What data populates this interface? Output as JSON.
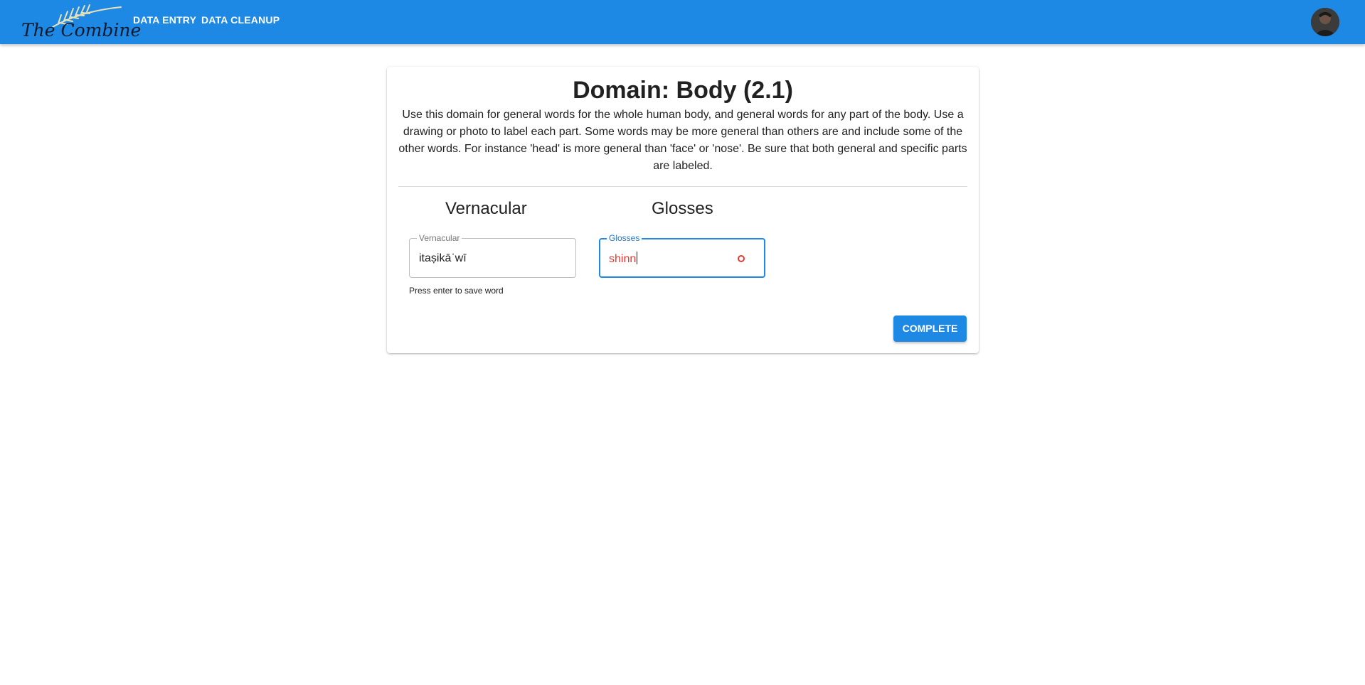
{
  "app": {
    "logo_text": "The Combine",
    "nav": {
      "data_entry": "DATA ENTRY",
      "data_cleanup": "DATA CLEANUP"
    },
    "accent_color": "#1e88e5"
  },
  "domain": {
    "title": "Domain: Body (2.1)",
    "description": "Use this domain for general words for the whole human body, and general words for any part of the body. Use a drawing or photo to label each part. Some words may be more general than others are and include some of the other words. For instance 'head' is more general than 'face' or 'nose'. Be sure that both general and specific parts are labeled."
  },
  "entry": {
    "vernacular_header": "Vernacular",
    "glosses_header": "Glosses",
    "vernacular_field": {
      "label": "Vernacular",
      "value": "itaṣikāˈwī"
    },
    "glosses_field": {
      "label": "Glosses",
      "value": "shinn",
      "status_color": "#e53935"
    },
    "helper_text": "Press enter to save word",
    "complete_label": "COMPLETE"
  },
  "icons": {
    "logo": "wheat-icon",
    "avatar": "user-avatar",
    "spellcheck": "spellcheck-indicator-icon"
  }
}
